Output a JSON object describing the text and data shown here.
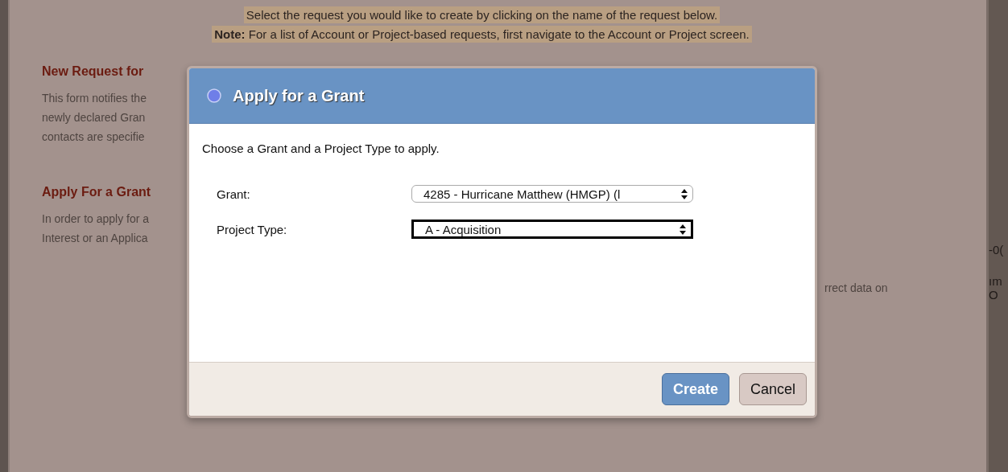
{
  "notice": {
    "line": "Select the request you would like to create by clicking on the name of the request below.",
    "note_label": "Note:",
    "note": "For a list of Account or Project-based requests, first navigate to the Account or Project screen."
  },
  "sections": [
    {
      "heading": "New Request for",
      "lines": [
        "This form notifies the",
        "newly declared Gran",
        "contacts are specifie"
      ]
    },
    {
      "heading": "Apply For a Grant",
      "lines": [
        "In order to apply for a",
        "Interest or an Applica"
      ]
    }
  ],
  "right_fragment": "rrect data on",
  "side_panel": [
    "-0(",
    "ım",
    "O"
  ],
  "dialog": {
    "title": "Apply for a Grant",
    "instruction": "Choose a Grant and a Project Type to apply.",
    "fields": [
      {
        "label": "Grant:",
        "value": "4285 - Hurricane Matthew (HMGP) (l",
        "focused": false
      },
      {
        "label": "Project Type:",
        "value": "A - Acquisition",
        "focused": true
      }
    ],
    "buttons": [
      {
        "label": "Create",
        "kind": "primary"
      },
      {
        "label": "Cancel",
        "kind": "secondary"
      }
    ]
  }
}
